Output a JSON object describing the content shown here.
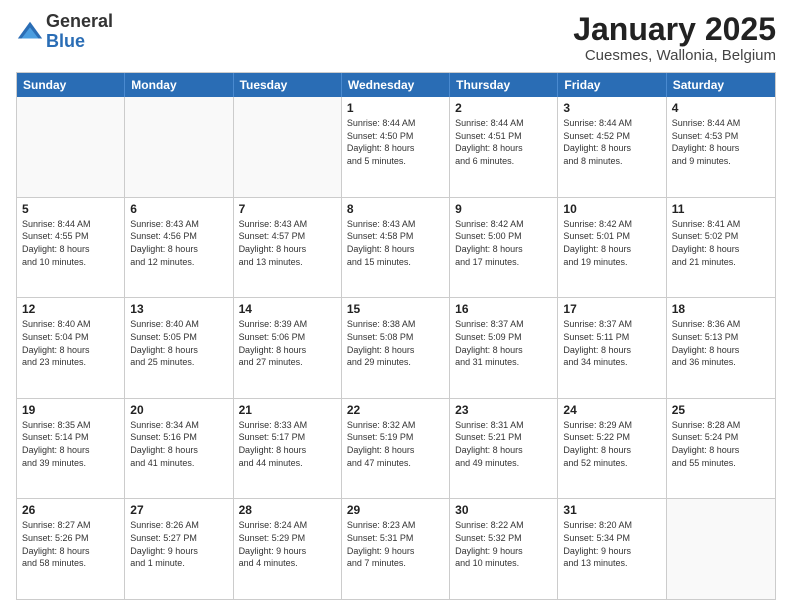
{
  "logo": {
    "general": "General",
    "blue": "Blue"
  },
  "title": {
    "month": "January 2025",
    "location": "Cuesmes, Wallonia, Belgium"
  },
  "header_days": [
    "Sunday",
    "Monday",
    "Tuesday",
    "Wednesday",
    "Thursday",
    "Friday",
    "Saturday"
  ],
  "rows": [
    [
      {
        "day": "",
        "info": "",
        "empty": true
      },
      {
        "day": "",
        "info": "",
        "empty": true
      },
      {
        "day": "",
        "info": "",
        "empty": true
      },
      {
        "day": "1",
        "info": "Sunrise: 8:44 AM\nSunset: 4:50 PM\nDaylight: 8 hours\nand 5 minutes.",
        "empty": false
      },
      {
        "day": "2",
        "info": "Sunrise: 8:44 AM\nSunset: 4:51 PM\nDaylight: 8 hours\nand 6 minutes.",
        "empty": false
      },
      {
        "day": "3",
        "info": "Sunrise: 8:44 AM\nSunset: 4:52 PM\nDaylight: 8 hours\nand 8 minutes.",
        "empty": false
      },
      {
        "day": "4",
        "info": "Sunrise: 8:44 AM\nSunset: 4:53 PM\nDaylight: 8 hours\nand 9 minutes.",
        "empty": false
      }
    ],
    [
      {
        "day": "5",
        "info": "Sunrise: 8:44 AM\nSunset: 4:55 PM\nDaylight: 8 hours\nand 10 minutes.",
        "empty": false
      },
      {
        "day": "6",
        "info": "Sunrise: 8:43 AM\nSunset: 4:56 PM\nDaylight: 8 hours\nand 12 minutes.",
        "empty": false
      },
      {
        "day": "7",
        "info": "Sunrise: 8:43 AM\nSunset: 4:57 PM\nDaylight: 8 hours\nand 13 minutes.",
        "empty": false
      },
      {
        "day": "8",
        "info": "Sunrise: 8:43 AM\nSunset: 4:58 PM\nDaylight: 8 hours\nand 15 minutes.",
        "empty": false
      },
      {
        "day": "9",
        "info": "Sunrise: 8:42 AM\nSunset: 5:00 PM\nDaylight: 8 hours\nand 17 minutes.",
        "empty": false
      },
      {
        "day": "10",
        "info": "Sunrise: 8:42 AM\nSunset: 5:01 PM\nDaylight: 8 hours\nand 19 minutes.",
        "empty": false
      },
      {
        "day": "11",
        "info": "Sunrise: 8:41 AM\nSunset: 5:02 PM\nDaylight: 8 hours\nand 21 minutes.",
        "empty": false
      }
    ],
    [
      {
        "day": "12",
        "info": "Sunrise: 8:40 AM\nSunset: 5:04 PM\nDaylight: 8 hours\nand 23 minutes.",
        "empty": false
      },
      {
        "day": "13",
        "info": "Sunrise: 8:40 AM\nSunset: 5:05 PM\nDaylight: 8 hours\nand 25 minutes.",
        "empty": false
      },
      {
        "day": "14",
        "info": "Sunrise: 8:39 AM\nSunset: 5:06 PM\nDaylight: 8 hours\nand 27 minutes.",
        "empty": false
      },
      {
        "day": "15",
        "info": "Sunrise: 8:38 AM\nSunset: 5:08 PM\nDaylight: 8 hours\nand 29 minutes.",
        "empty": false
      },
      {
        "day": "16",
        "info": "Sunrise: 8:37 AM\nSunset: 5:09 PM\nDaylight: 8 hours\nand 31 minutes.",
        "empty": false
      },
      {
        "day": "17",
        "info": "Sunrise: 8:37 AM\nSunset: 5:11 PM\nDaylight: 8 hours\nand 34 minutes.",
        "empty": false
      },
      {
        "day": "18",
        "info": "Sunrise: 8:36 AM\nSunset: 5:13 PM\nDaylight: 8 hours\nand 36 minutes.",
        "empty": false
      }
    ],
    [
      {
        "day": "19",
        "info": "Sunrise: 8:35 AM\nSunset: 5:14 PM\nDaylight: 8 hours\nand 39 minutes.",
        "empty": false
      },
      {
        "day": "20",
        "info": "Sunrise: 8:34 AM\nSunset: 5:16 PM\nDaylight: 8 hours\nand 41 minutes.",
        "empty": false
      },
      {
        "day": "21",
        "info": "Sunrise: 8:33 AM\nSunset: 5:17 PM\nDaylight: 8 hours\nand 44 minutes.",
        "empty": false
      },
      {
        "day": "22",
        "info": "Sunrise: 8:32 AM\nSunset: 5:19 PM\nDaylight: 8 hours\nand 47 minutes.",
        "empty": false
      },
      {
        "day": "23",
        "info": "Sunrise: 8:31 AM\nSunset: 5:21 PM\nDaylight: 8 hours\nand 49 minutes.",
        "empty": false
      },
      {
        "day": "24",
        "info": "Sunrise: 8:29 AM\nSunset: 5:22 PM\nDaylight: 8 hours\nand 52 minutes.",
        "empty": false
      },
      {
        "day": "25",
        "info": "Sunrise: 8:28 AM\nSunset: 5:24 PM\nDaylight: 8 hours\nand 55 minutes.",
        "empty": false
      }
    ],
    [
      {
        "day": "26",
        "info": "Sunrise: 8:27 AM\nSunset: 5:26 PM\nDaylight: 8 hours\nand 58 minutes.",
        "empty": false
      },
      {
        "day": "27",
        "info": "Sunrise: 8:26 AM\nSunset: 5:27 PM\nDaylight: 9 hours\nand 1 minute.",
        "empty": false
      },
      {
        "day": "28",
        "info": "Sunrise: 8:24 AM\nSunset: 5:29 PM\nDaylight: 9 hours\nand 4 minutes.",
        "empty": false
      },
      {
        "day": "29",
        "info": "Sunrise: 8:23 AM\nSunset: 5:31 PM\nDaylight: 9 hours\nand 7 minutes.",
        "empty": false
      },
      {
        "day": "30",
        "info": "Sunrise: 8:22 AM\nSunset: 5:32 PM\nDaylight: 9 hours\nand 10 minutes.",
        "empty": false
      },
      {
        "day": "31",
        "info": "Sunrise: 8:20 AM\nSunset: 5:34 PM\nDaylight: 9 hours\nand 13 minutes.",
        "empty": false
      },
      {
        "day": "",
        "info": "",
        "empty": true
      }
    ]
  ]
}
